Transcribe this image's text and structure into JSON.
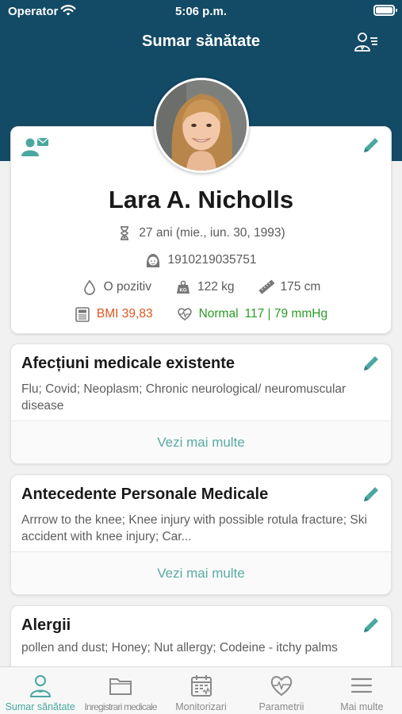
{
  "status_bar": {
    "carrier": "Operator",
    "time": "5:06 p.m."
  },
  "header": {
    "title": "Sumar sănătate"
  },
  "profile": {
    "name": "Lara A. Nicholls",
    "age": "27 ani (mie., iun. 30, 1993)",
    "cnp": "1910219035751",
    "blood_type": "O pozitiv",
    "weight": "122 kg",
    "height": "175 cm",
    "bmi": "BMI 39,83",
    "bp_status": "Normal",
    "bp_value": "117 | 79 mmHg"
  },
  "sections": [
    {
      "title": "Afecțiuni medicale existente",
      "body": "Flu; Covid; Neoplasm; Chronic neurological/ neuromuscular disease",
      "link": "Vezi mai multe"
    },
    {
      "title": "Antecedente Personale Medicale",
      "body": "Arrrow to the knee; Knee injury with possible rotula fracture; Ski accident with knee injury; Car...",
      "link": "Vezi mai multe"
    },
    {
      "title": "Alergii",
      "body": "pollen and dust; Honey; Nut allergy; Codeine - itchy palms"
    }
  ],
  "tabs": [
    {
      "label": "Sumar sănătate",
      "icon": "person-icon",
      "active": true
    },
    {
      "label": "Inregistrari medicale",
      "icon": "folder-icon"
    },
    {
      "label": "Monitorizari",
      "icon": "calendar-icon"
    },
    {
      "label": "Parametrii",
      "icon": "heart-pulse-icon"
    },
    {
      "label": "Mai multe",
      "icon": "menu-icon"
    }
  ],
  "colors": {
    "header_bg": "#134a66",
    "accent": "#4aa8a0",
    "bmi": "#e0541b",
    "bp_normal": "#2a9d24"
  }
}
